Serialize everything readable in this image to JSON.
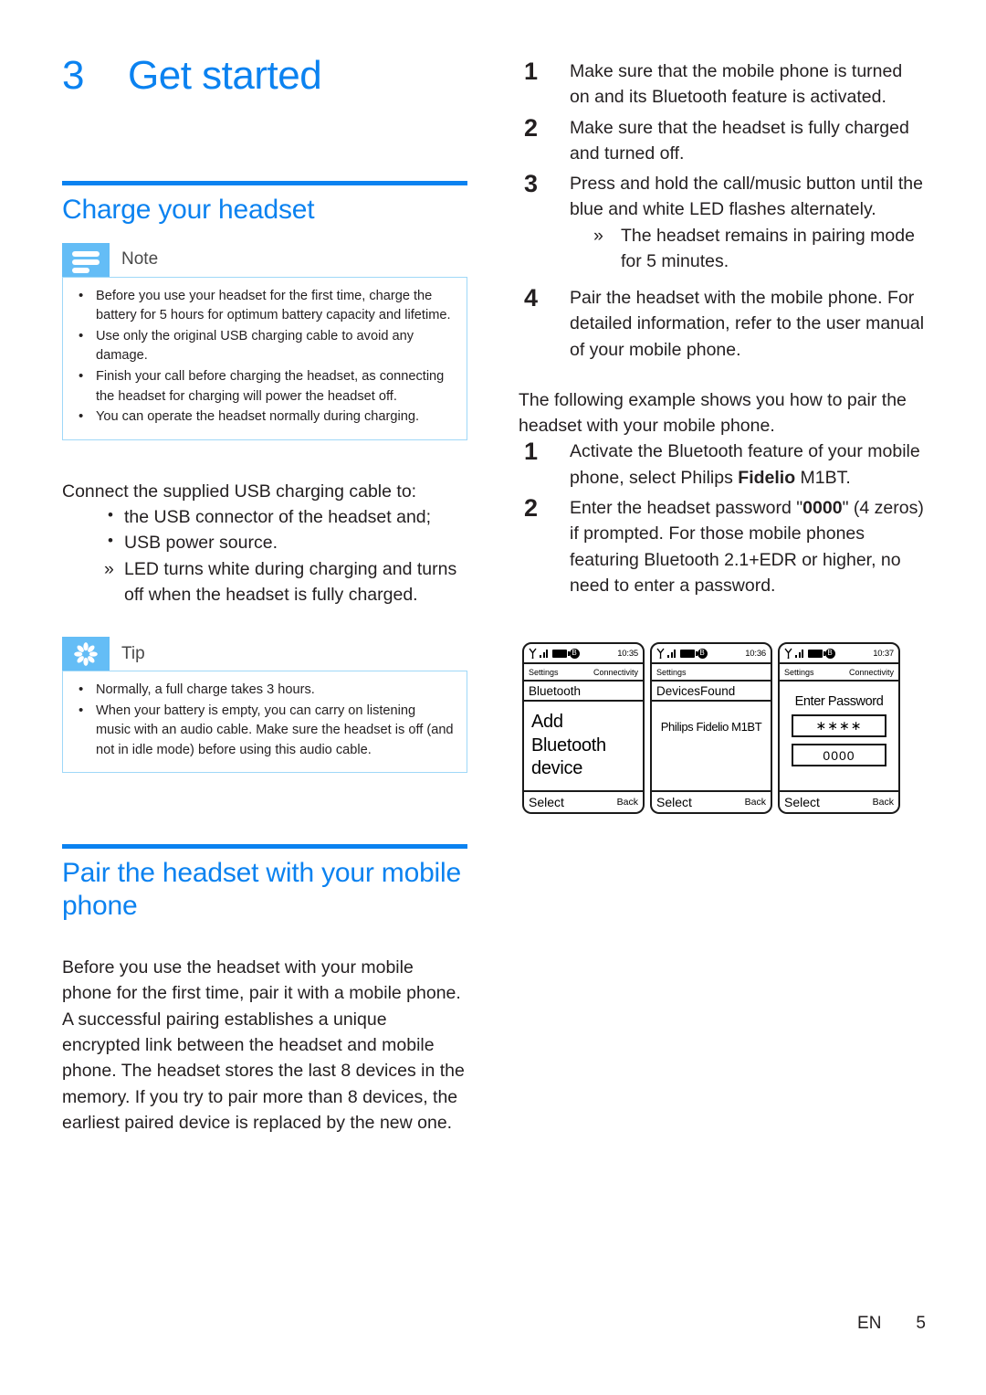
{
  "chapter": {
    "number": "3",
    "title": "Get started"
  },
  "left_column": {
    "section1": {
      "heading": "Charge your headset",
      "note": {
        "label": "Note",
        "icon": "note-lines-icon",
        "items": [
          "Before you use your headset for the first time, charge the battery for 5 hours for optimum battery capacity and lifetime.",
          "Use only the original USB charging cable to avoid any damage.",
          "Finish your call before charging the headset, as connecting the headset for charging will power the headset off.",
          "You can operate the headset normally during charging."
        ]
      },
      "intro": "Connect the supplied USB charging cable to:",
      "bullets": [
        {
          "marker": "•",
          "text": "the USB connector of the headset and;"
        },
        {
          "marker": "•",
          "text": "USB power source."
        },
        {
          "marker": "»",
          "text": "LED turns white during charging and turns off when the headset is fully charged."
        }
      ],
      "tip": {
        "label": "Tip",
        "icon": "asterisk-icon",
        "items": [
          "Normally, a full charge takes 3 hours.",
          "When your battery is empty, you can carry on listening music with an audio cable. Make sure the headset is off (and not in idle mode) before using this audio cable."
        ]
      }
    },
    "section2": {
      "heading": "Pair the headset with your mobile phone",
      "paragraph": "Before you use the headset with your mobile phone for the first time, pair it with a mobile phone. A successful pairing establishes a unique encrypted link between the headset and mobile phone. The headset stores the last 8 devices in the memory. If you try to pair more than 8 devices, the earliest paired device is replaced by the new one."
    }
  },
  "right_column": {
    "steps": [
      {
        "number": "1",
        "text": "Make sure that the mobile phone is turned on and its Bluetooth feature is activated.",
        "sub": []
      },
      {
        "number": "2",
        "text": "Make sure that the headset is fully charged and turned off.",
        "sub": []
      },
      {
        "number": "3",
        "text": "Press and hold the call/music button until the blue and white LED flashes alternately.",
        "sub": [
          {
            "marker": "»",
            "text": "The headset remains in pairing mode for 5 minutes."
          }
        ]
      },
      {
        "number": "4",
        "text": "Pair the headset with the mobile phone. For detailed information, refer to the user manual of your mobile phone.",
        "sub": []
      }
    ],
    "example_intro": "The following example shows you how to pair the headset with your mobile phone.",
    "example_steps": [
      {
        "number": "1",
        "pre": "Activate the Bluetooth feature of your mobile phone, select Philips ",
        "bold": "Fidelio",
        "post": " M1BT."
      },
      {
        "number": "2",
        "pre": "Enter the headset password \"",
        "bold": "0000",
        "post": "\" (4 zeros) if prompted. For those mobile phones featuring Bluetooth 2.1+EDR or higher, no need to enter a password."
      }
    ]
  },
  "phone_screens": [
    {
      "name": "add-bluetooth-device",
      "time": "10:35",
      "crumb_left": "Settings",
      "crumb_right": "Connectivity",
      "title": "Bluetooth",
      "content": "Add Bluetooth device",
      "softkey_left": "Select",
      "softkey_right": "Back"
    },
    {
      "name": "devices-found",
      "time": "10:36",
      "crumb_left": "Settings",
      "crumb_right": "",
      "title": "DevicesFound",
      "content": "Philips Fidelio M1BT",
      "softkey_left": "Select",
      "softkey_right": "Back"
    },
    {
      "name": "enter-password",
      "time": "10:37",
      "crumb_left": "Settings",
      "crumb_right": "Connectivity",
      "title": "",
      "password_label": "Enter Password",
      "password_masked": "∗∗∗∗",
      "password_value": "0000",
      "softkey_left": "Select",
      "softkey_right": "Back"
    }
  ],
  "footer": {
    "language": "EN",
    "page": "5"
  },
  "colors": {
    "brand_blue": "#0b82f0",
    "callout_badge": "#64bdf6",
    "callout_border": "#9fd8f8",
    "text": "#231f20"
  }
}
